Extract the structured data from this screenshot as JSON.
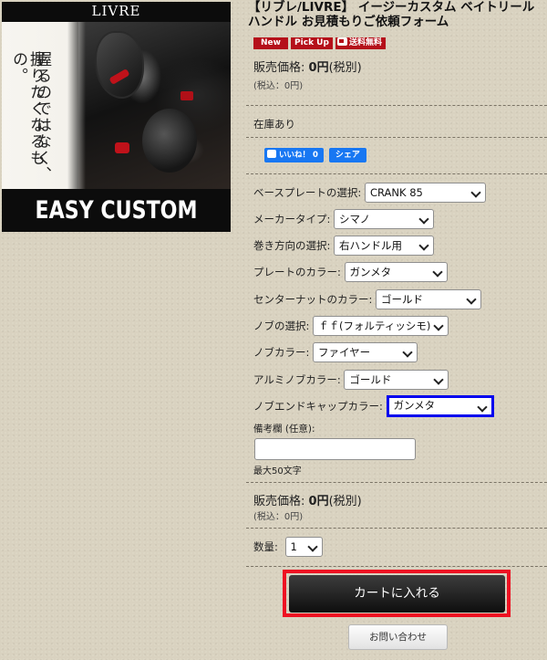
{
  "image": {
    "brand": "LIVRE",
    "tagline_lines": [
      "握るのではなく、",
      "握りたくなるもの。"
    ],
    "footer": "EASY CUSTOM"
  },
  "product": {
    "title": "【リブレ/LIVRE】 イージーカスタム ベイトリール ハンドル お見積もりご依頼フォーム",
    "badges": {
      "new": "New",
      "pickup": "Pick Up",
      "shipping": "送料無料"
    },
    "price_label": "販売価格:",
    "price_value": "0円",
    "price_tax_note": "(税別)",
    "price_incl": "(税込：0円)",
    "stock": "在庫あり"
  },
  "social": {
    "like": "いいね！ 0",
    "share": "シェア"
  },
  "options": [
    {
      "label": "ベースプレートの選択:",
      "value": "CRANK 85"
    },
    {
      "label": "メーカータイプ:",
      "value": "シマノ"
    },
    {
      "label": "巻き方向の選択:",
      "value": "右ハンドル用"
    },
    {
      "label": "プレートのカラー:",
      "value": "ガンメタ"
    },
    {
      "label": "センターナットのカラー:",
      "value": "ゴールド"
    },
    {
      "label": "ノブの選択:",
      "value": "ｆｆ(フォルティッシモ)"
    },
    {
      "label": "ノブカラー:",
      "value": "ファイヤー"
    },
    {
      "label": "アルミノブカラー:",
      "value": "ゴールド"
    },
    {
      "label": "ノブエンドキャップカラー:",
      "value": "ガンメタ"
    }
  ],
  "memo": {
    "label": "備考欄 (任意):",
    "value": "",
    "note": "最大50文字"
  },
  "quantity": {
    "label": "数量:",
    "value": "1"
  },
  "buttons": {
    "cart": "カートに入れる",
    "inquiry": "お問い合わせ"
  },
  "colors": {
    "badge_red": "#b5101a",
    "highlight_blue": "#0000ee",
    "cart_outline": "#ee1122",
    "facebook_blue": "#1877f2"
  }
}
